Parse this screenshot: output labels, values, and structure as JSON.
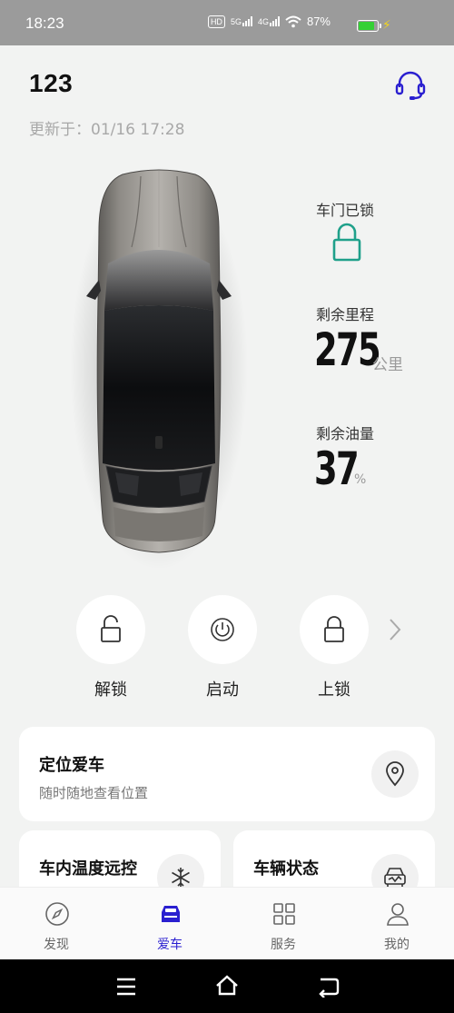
{
  "status_bar": {
    "time": "18:23",
    "hd_chip": "HD",
    "net1": "5G",
    "net2": "4G",
    "battery_percent": "87%",
    "battery_level": 0.87
  },
  "header": {
    "car_name": "123",
    "updated_text": "更新于：01/16 17:28"
  },
  "vehicle_status": {
    "door_label": "车门已锁",
    "range_label": "剩余里程",
    "range_value": "275",
    "range_unit": "公里",
    "fuel_label": "剩余油量",
    "fuel_value": "37",
    "fuel_unit": "%"
  },
  "actions": [
    {
      "label": "解锁",
      "icon": "unlock-icon"
    },
    {
      "label": "启动",
      "icon": "power-icon"
    },
    {
      "label": "上锁",
      "icon": "lock-icon"
    }
  ],
  "cards": {
    "locate": {
      "title": "定位爱车",
      "subtitle": "随时随地查看位置",
      "icon": "location-pin-icon"
    },
    "climate": {
      "title": "车内温度远控",
      "icon": "snowflake-icon"
    },
    "status": {
      "title": "车辆状态",
      "icon": "car-status-icon"
    }
  },
  "tabs": [
    {
      "label": "发现",
      "icon": "compass-icon",
      "active": false
    },
    {
      "label": "爱车",
      "icon": "car-icon",
      "active": true
    },
    {
      "label": "服务",
      "icon": "grid-icon",
      "active": false
    },
    {
      "label": "我的",
      "icon": "person-icon",
      "active": false
    }
  ],
  "colors": {
    "accent": "#2a1fd0",
    "lock_green": "#1fa08a",
    "background": "#f2f3f2"
  }
}
